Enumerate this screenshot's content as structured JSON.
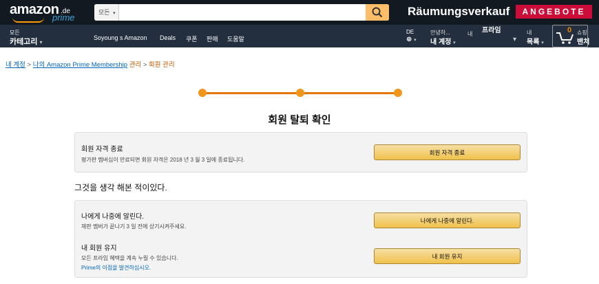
{
  "header": {
    "logo": {
      "word": "amazon",
      "tld": ".de",
      "sub": "prime"
    },
    "search": {
      "category": "모든",
      "value": "",
      "placeholder": ""
    },
    "promo": {
      "text": "Räumungsverkauf",
      "badge": "ANGEBOTE"
    },
    "categories": {
      "small": "모든",
      "big": "카테고리"
    },
    "links": [
      "Soyoung s Amazon",
      "Deals",
      "쿠폰",
      "판매",
      "도움말"
    ],
    "lang": {
      "code": "DE"
    },
    "account": {
      "small": "안녕하...",
      "big": "내 계정"
    },
    "prime": {
      "small": "내",
      "big": "프라임"
    },
    "lists": {
      "small": "내",
      "big": "목록"
    },
    "cart": {
      "count": "0",
      "small": "쇼핑",
      "big": "밴처"
    }
  },
  "breadcrumb": {
    "item1": "내 계정",
    "sep1": ">",
    "item2": "나의 Amazon Prime Membership",
    "item3": "관리",
    "sep2": ">",
    "item4": "회원 관리"
  },
  "progress": {
    "steps": 3,
    "current": 3
  },
  "heading": "회원 탈퇴 확인",
  "end_option": {
    "title": "회원 자격 종료",
    "desc": "평가판 멤버십이 만료되면 회원 자격은 2018 년 3 월 3 일에 종료됩니다.",
    "button": "회원 자격 종료"
  },
  "think": "그것을 생각 해본 적이있다.",
  "remind_option": {
    "title": "나에게 나중에 알린다.",
    "desc": "재판 멤버가 끝나기 3 일 전에 상기시켜주세요.",
    "button": "나에게 나중에 알린다."
  },
  "keep_option": {
    "title": "내 회원 유지",
    "desc": "모든 프라임 혜택을 계속 누릴 수 있습니다.",
    "link": "Prime의 이점을 발견하십시오.",
    "button": "내 회원 유지"
  },
  "colors": {
    "nav_top": "#131921",
    "nav_sub": "#232f3e",
    "accent": "#f0961b",
    "badge": "#cc0c39",
    "link": "#0066c0",
    "button": "#f0c14b"
  }
}
